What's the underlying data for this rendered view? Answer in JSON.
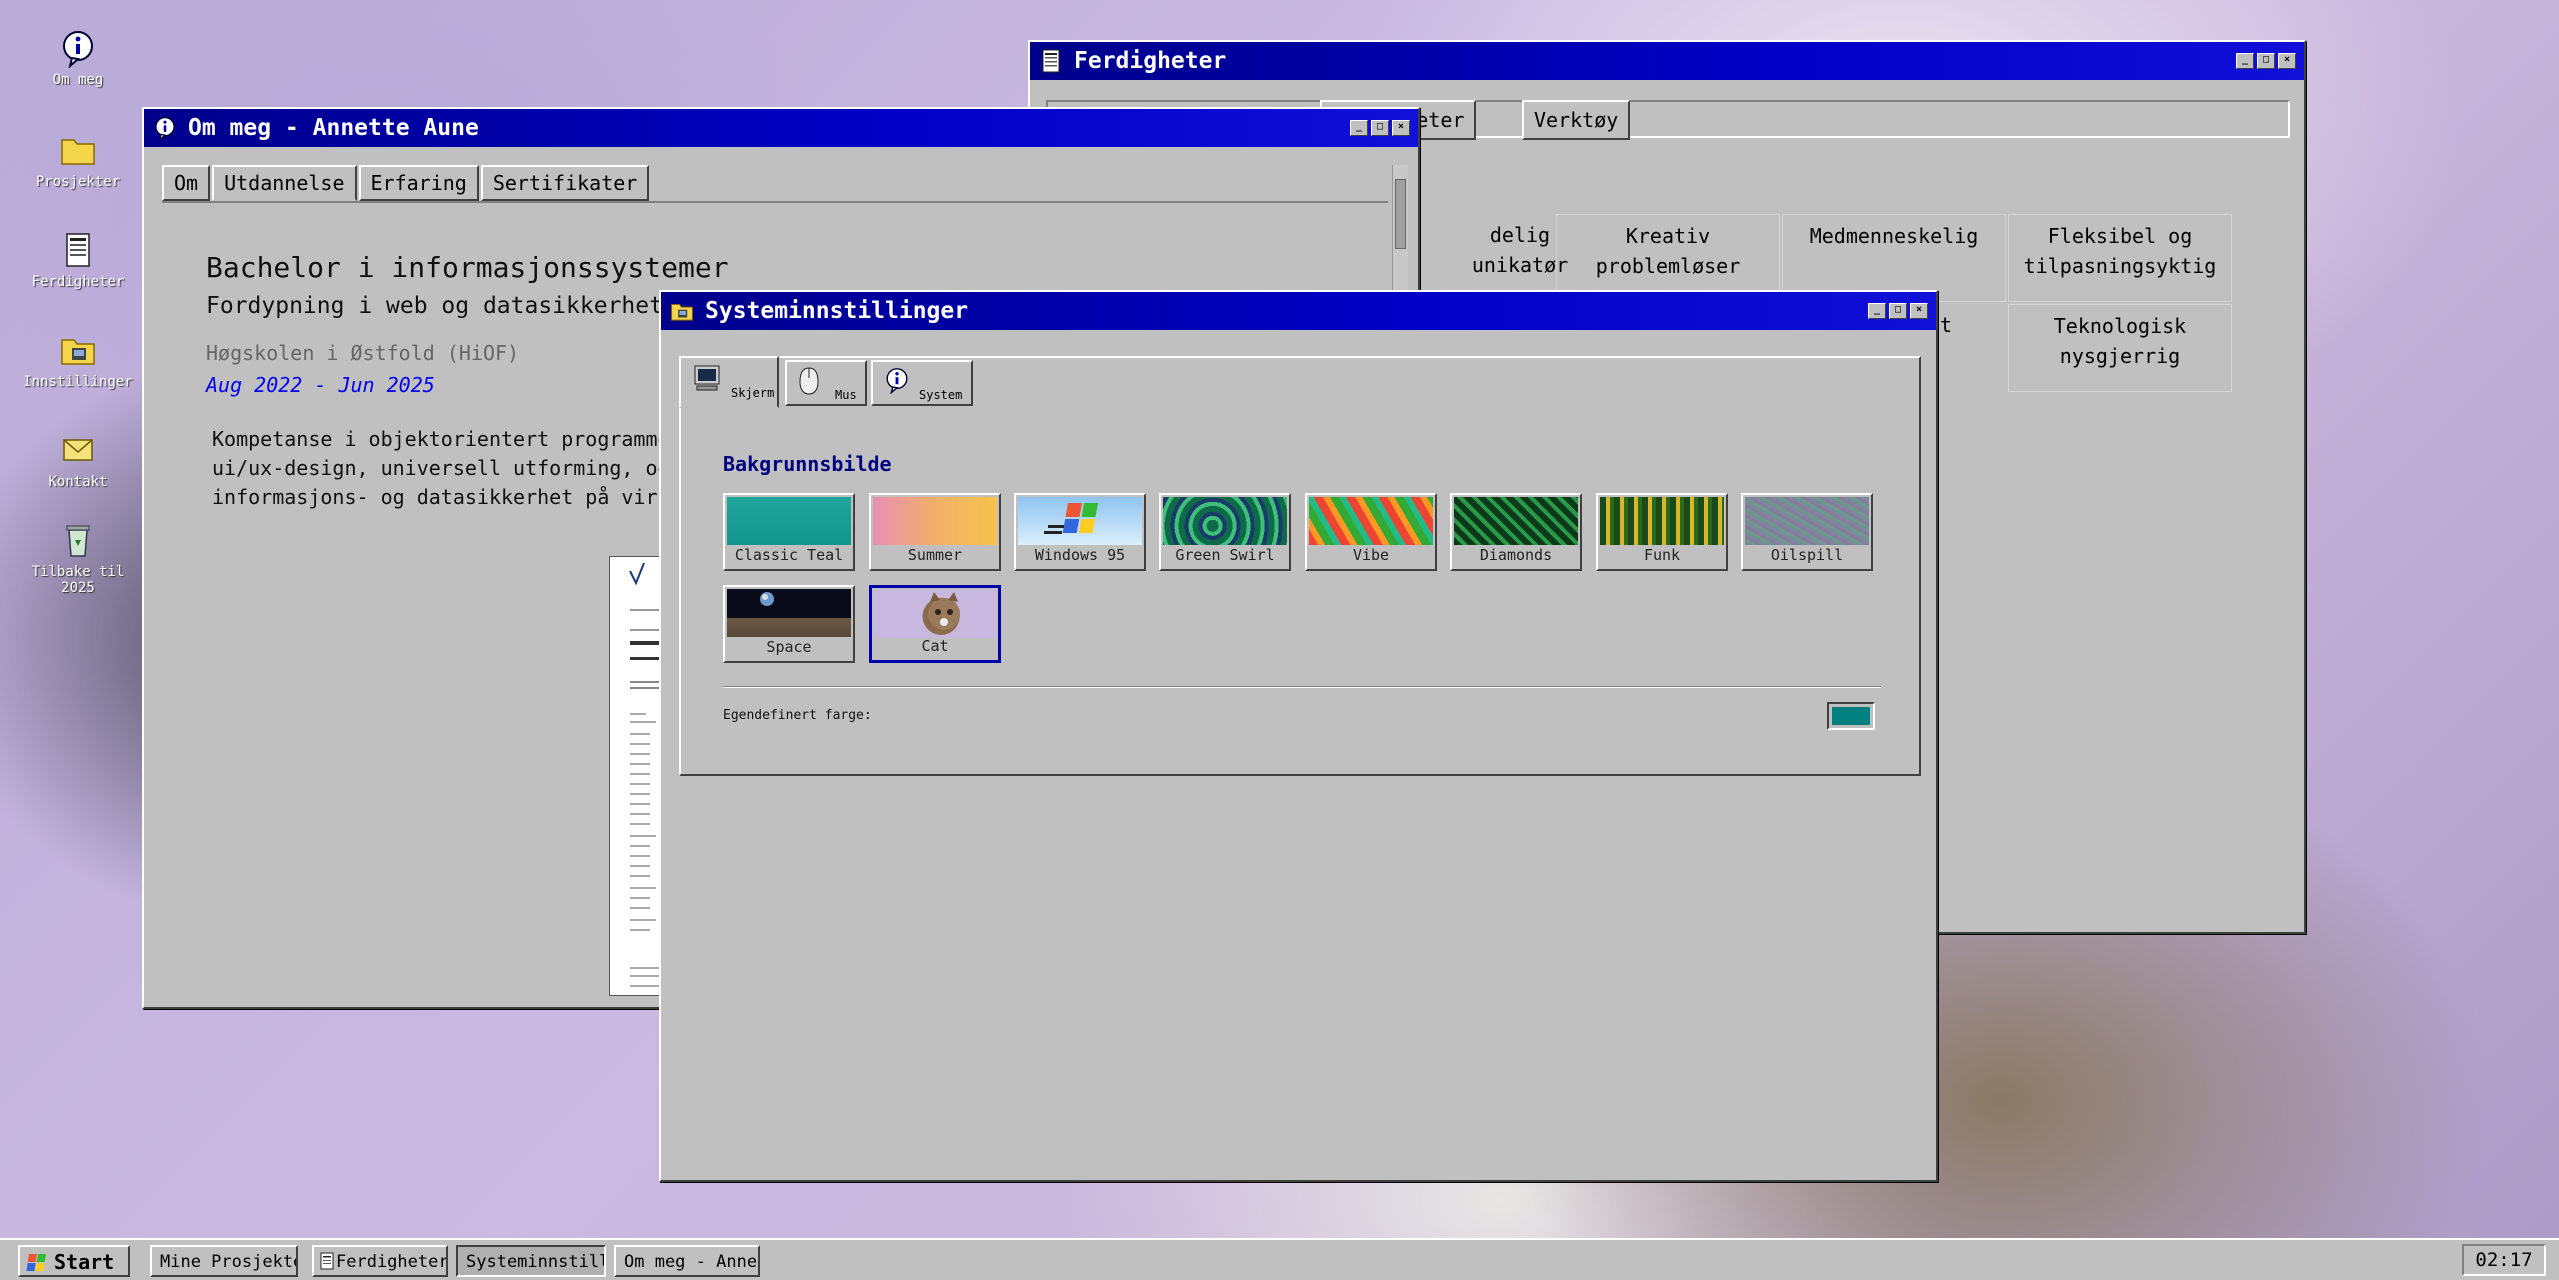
{
  "desktop": {
    "icons": [
      {
        "label": "Om meg",
        "icon": "info-icon"
      },
      {
        "label": "Prosjekter",
        "icon": "folder-icon"
      },
      {
        "label": "Ferdigheter",
        "icon": "document-icon"
      },
      {
        "label": "Innstillinger",
        "icon": "settings-icon"
      },
      {
        "label": "Kontakt",
        "icon": "mail-icon"
      },
      {
        "label": "Tilbake til 2025",
        "icon": "recycle-icon"
      }
    ]
  },
  "ferdigheter": {
    "title": "Ferdigheter",
    "tabs": [
      "Ferdigheter",
      "Verktøy"
    ],
    "skills": [
      [
        "delig\nunikatør",
        "Kreativ\nproblemløser",
        "Medmenneskelig",
        "Fleksibel og\ntilpasningsyktig"
      ],
      [
        "sst",
        "Teknologisk\nnysgjerrig"
      ]
    ]
  },
  "ommeg": {
    "title": "Om meg - Annette Aune",
    "tabs": [
      "Om",
      "Utdannelse",
      "Erfaring",
      "Sertifikater"
    ],
    "degree": "Bachelor i informasjonssystemer",
    "specialization": "Fordypning i web og datasikkerhet",
    "school": "Høgskolen i Østfold (HiOF)",
    "period": "Aug 2022 - Jun 2025",
    "description": [
      "Kompetanse i objektorientert programmer",
      "ui/ux-design, universell utforming, og",
      "informasjons- og datasikkerhet på virks"
    ]
  },
  "settings": {
    "title": "Systeminnstillinger",
    "tabs": [
      {
        "label": "Skjerm",
        "icon": "monitor-icon"
      },
      {
        "label": "Mus",
        "icon": "mouse-icon"
      },
      {
        "label": "System",
        "icon": "info-icon"
      }
    ],
    "section_title": "Bakgrunnsbilde",
    "wallpapers": [
      "Classic Teal",
      "Summer",
      "Windows 95",
      "Green Swirl",
      "Vibe",
      "Diamonds",
      "Funk",
      "Oilspill",
      "Space",
      "Cat"
    ],
    "selected": "Cat",
    "custom_color_label": "Egendefinert farge:",
    "custom_color": "#008080"
  },
  "taskbar": {
    "start_label": "Start",
    "items": [
      "Mine Prosjekter",
      "Ferdigheter",
      "Systeminnstillinger",
      "Om meg - Annette Aune"
    ],
    "active": "Systeminnstillinger",
    "clock": "02:17"
  }
}
